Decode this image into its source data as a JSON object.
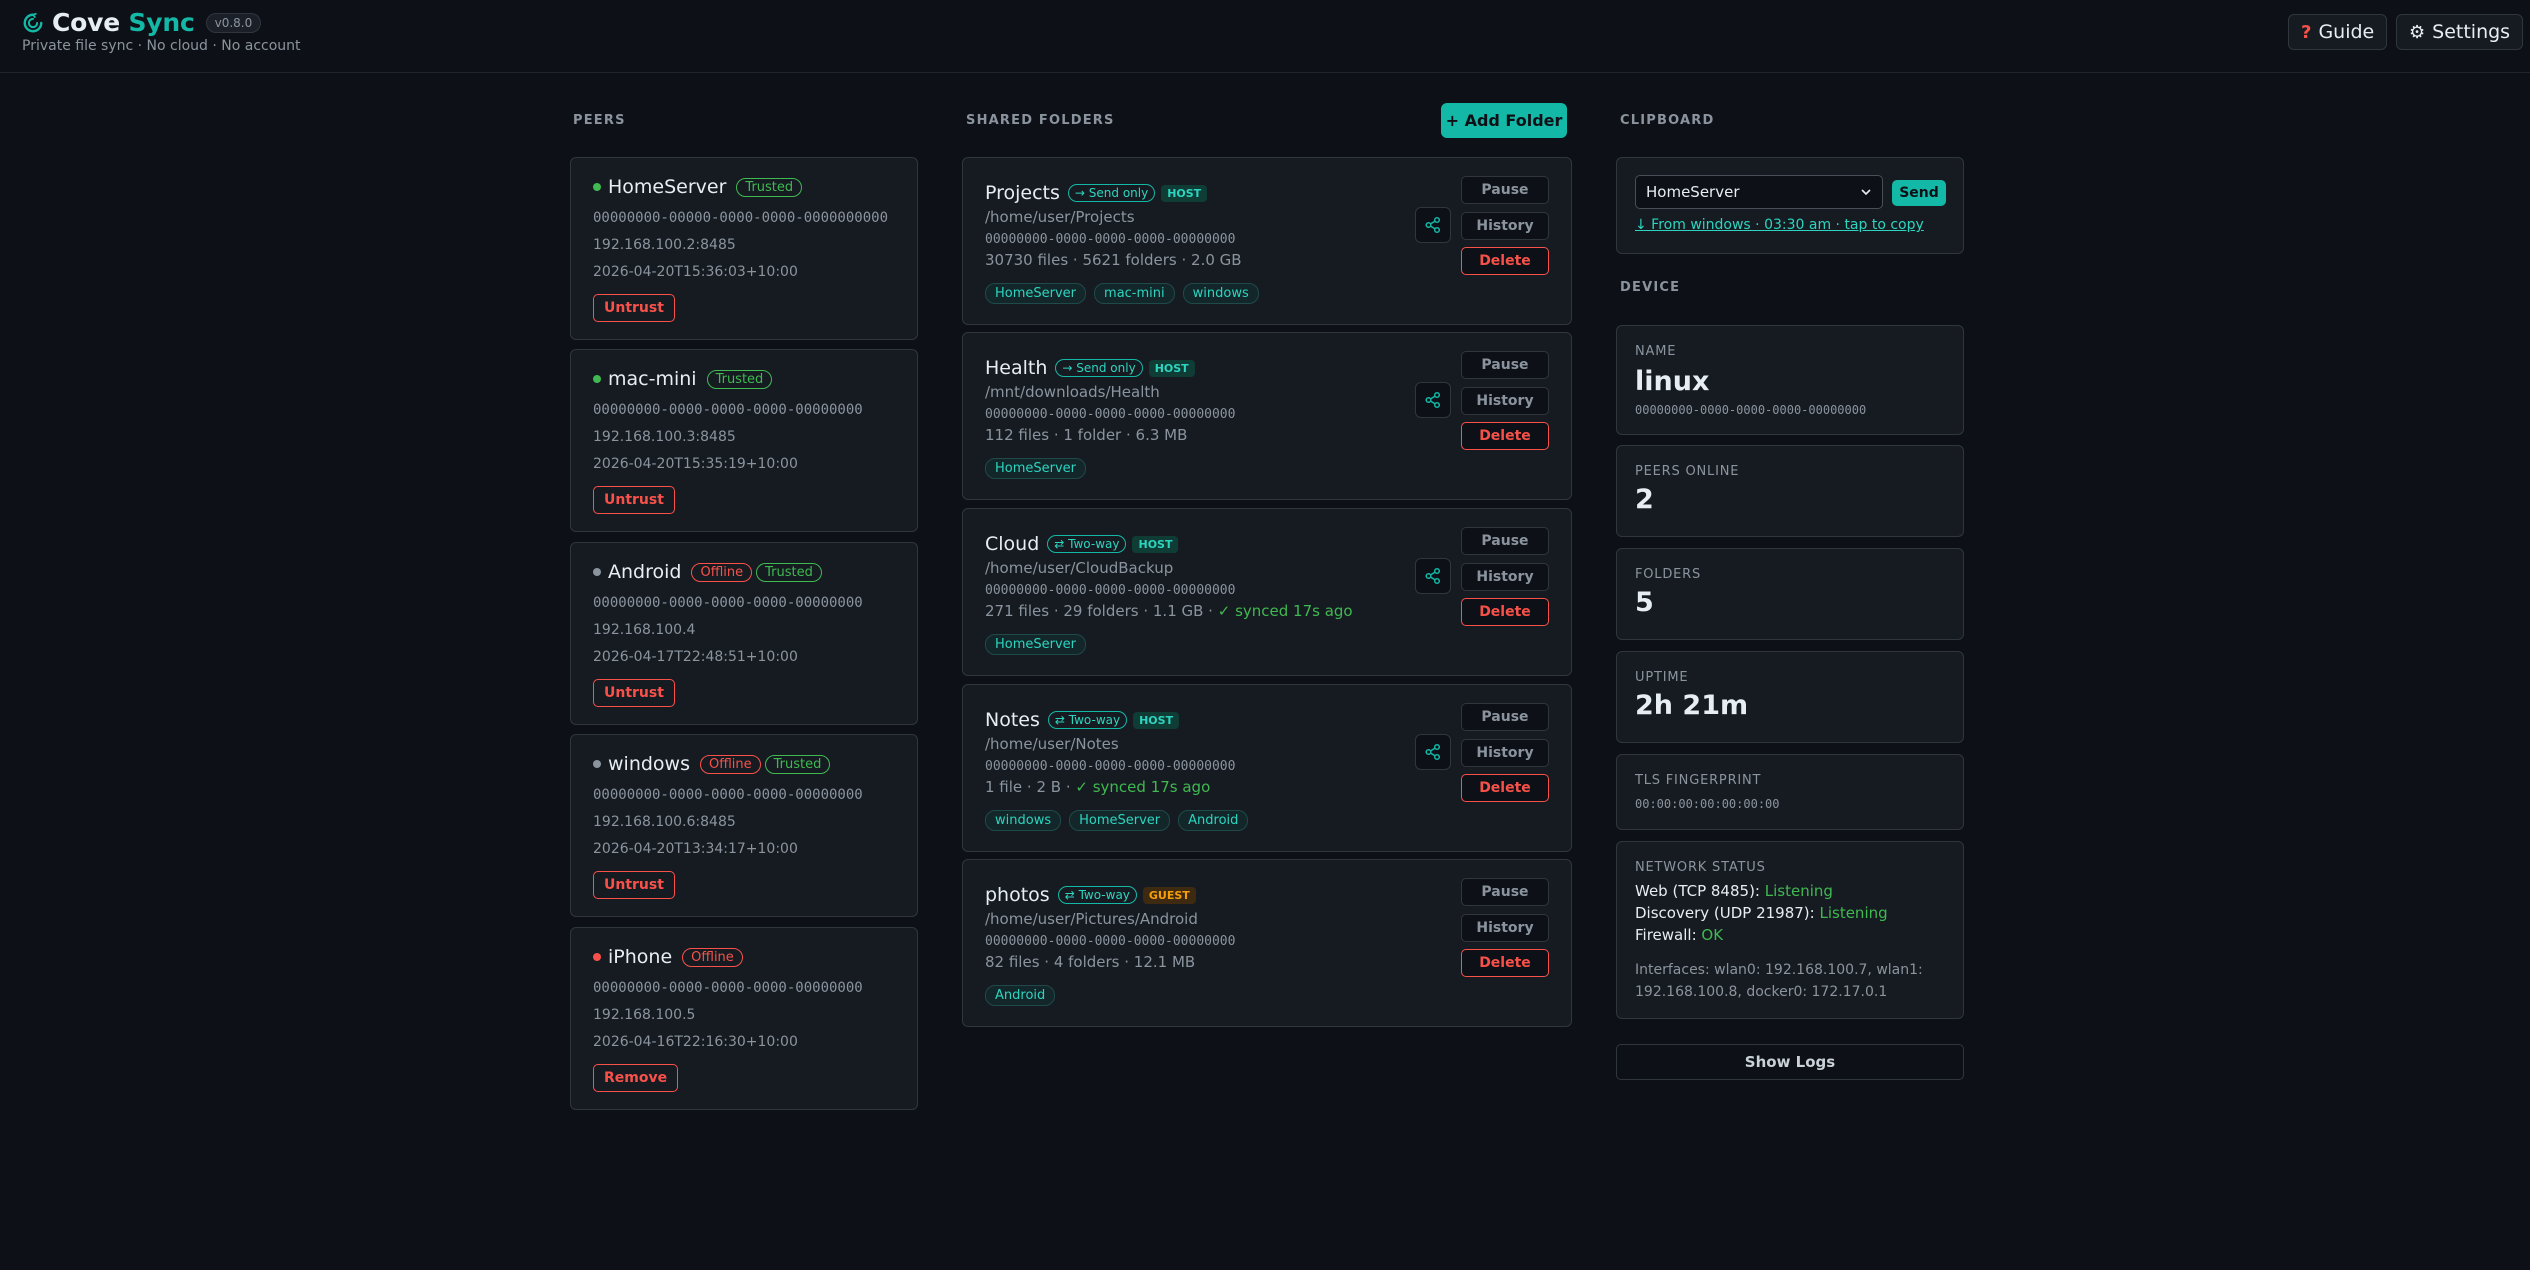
{
  "header": {
    "brand_part1": "Cove",
    "brand_part2": "Sync",
    "version": "v0.8.0",
    "tagline": "Private file sync · No cloud · No account",
    "guide_label": "Guide",
    "settings_label": "Settings",
    "guide_icon": "question-icon",
    "settings_icon": "gear-icon"
  },
  "sections": {
    "peers": "PEERS",
    "shared_folders": "SHARED FOLDERS",
    "clipboard": "CLIPBOARD",
    "device": "DEVICE"
  },
  "colors": {
    "accent": "#14b8a6",
    "online": "#3fb950",
    "offline_red": "#f85149",
    "offline_grey": "#8b949e"
  },
  "peers": [
    {
      "name": "HomeServer",
      "status": "online",
      "badges": [
        "Trusted"
      ],
      "id": "00000000-00000-0000-0000-0000000000",
      "address": "192.168.100.2:8485",
      "last_seen": "2026-04-20T15:36:03+10:00",
      "action": "Untrust"
    },
    {
      "name": "mac-mini",
      "status": "online",
      "badges": [
        "Trusted"
      ],
      "id": "00000000-0000-0000-0000-00000000",
      "address": "192.168.100.3:8485",
      "last_seen": "2026-04-20T15:35:19+10:00",
      "action": "Untrust"
    },
    {
      "name": "Android",
      "status": "offline",
      "badges": [
        "Offline",
        "Trusted"
      ],
      "id": "00000000-0000-0000-0000-00000000",
      "address": "192.168.100.4",
      "last_seen": "2026-04-17T22:48:51+10:00",
      "action": "Untrust"
    },
    {
      "name": "windows",
      "status": "offline",
      "badges": [
        "Offline",
        "Trusted"
      ],
      "id": "00000000-0000-0000-0000-00000000",
      "address": "192.168.100.6:8485",
      "last_seen": "2026-04-20T13:34:17+10:00",
      "action": "Untrust"
    },
    {
      "name": "iPhone",
      "status": "offline-untrusted",
      "badges": [
        "Offline"
      ],
      "id": "00000000-0000-0000-0000-00000000",
      "address": "192.168.100.5",
      "last_seen": "2026-04-16T22:16:30+10:00",
      "action": "Remove"
    }
  ],
  "folders_header": {
    "add_label": "+ Add Folder"
  },
  "folders": [
    {
      "name": "Projects",
      "mode": "→ Send only",
      "role": "HOST",
      "path": "/home/user/Projects",
      "id": "00000000-0000-0000-0000-00000000",
      "stats": "30730 files · 5621 folders · 2.0 GB",
      "sync": "",
      "tags": [
        "HomeServer",
        "mac-mini",
        "windows"
      ]
    },
    {
      "name": "Health",
      "mode": "→ Send only",
      "role": "HOST",
      "path": "/mnt/downloads/Health",
      "id": "00000000-0000-0000-0000-00000000",
      "stats": "112 files · 1 folder · 6.3 MB",
      "sync": "",
      "tags": [
        "HomeServer"
      ]
    },
    {
      "name": "Cloud",
      "mode": "⇄ Two-way",
      "role": "HOST",
      "path": "/home/user/CloudBackup",
      "id": "00000000-0000-0000-0000-00000000",
      "stats": "271 files · 29 folders · 1.1 GB ·",
      "sync": "✓ synced 17s ago",
      "tags": [
        "HomeServer"
      ]
    },
    {
      "name": "Notes",
      "mode": "⇄ Two-way",
      "role": "HOST",
      "path": "/home/user/Notes",
      "id": "00000000-0000-0000-0000-00000000",
      "stats": "1 file · 2 B ·",
      "sync": "✓ synced 17s ago",
      "tags": [
        "windows",
        "HomeServer",
        "Android"
      ]
    },
    {
      "name": "photos",
      "mode": "⇄ Two-way",
      "role": "GUEST",
      "path": "/home/user/Pictures/Android",
      "id": "00000000-0000-0000-0000-00000000",
      "stats": "82 files · 4 folders · 12.1 MB",
      "sync": "",
      "tags": [
        "Android"
      ]
    }
  ],
  "folder_buttons": {
    "pause": "Pause",
    "history": "History",
    "delete": "Delete"
  },
  "clipboard": {
    "selected_peer": "HomeServer",
    "send_label": "Send",
    "last_clip": "↓ From windows · 03:30 am · tap to copy"
  },
  "device": {
    "name_label": "NAME",
    "name": "linux",
    "id": "00000000-0000-0000-0000-00000000",
    "peers_online_label": "PEERS ONLINE",
    "peers_online": "2",
    "folders_label": "FOLDERS",
    "folders": "5",
    "uptime_label": "UPTIME",
    "uptime": "2h 21m",
    "tls_label": "TLS FINGERPRINT",
    "tls": "00:00:00:00:00:00:00"
  },
  "network": {
    "label": "NETWORK STATUS",
    "web_label": "Web (TCP 8485):",
    "web_status": "Listening",
    "discovery_label": "Discovery (UDP 21987):",
    "discovery_status": "Listening",
    "firewall_label": "Firewall:",
    "firewall_status": "OK",
    "interfaces": "Interfaces: wlan0: 192.168.100.7, wlan1: 192.168.100.8, docker0: 172.17.0.1"
  },
  "logs_label": "Show Logs"
}
